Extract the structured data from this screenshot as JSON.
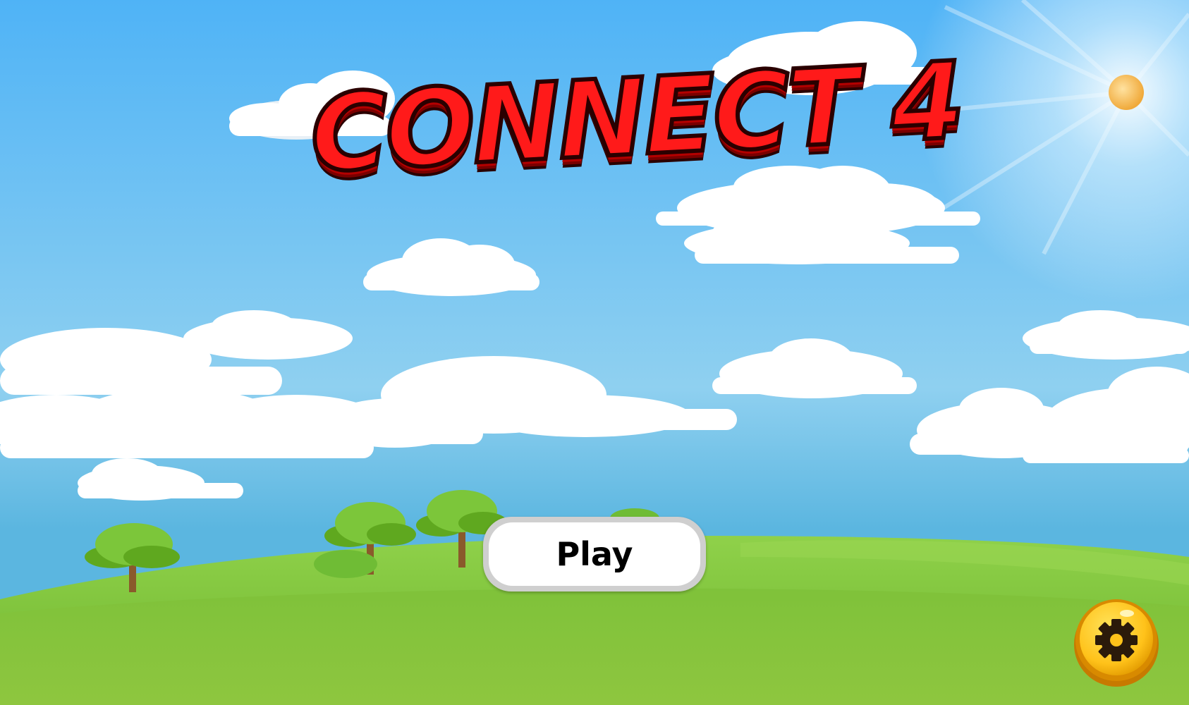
{
  "game": {
    "title": "CONNECT 4",
    "play_label": "Play",
    "settings_icon": "gear-icon"
  },
  "colors": {
    "sky_top": "#4fb3f6",
    "sky_bottom": "#bfe6f3",
    "grass": "#8cc63f",
    "title_red": "#ff1a1a",
    "settings_gold": "#ffc21a"
  }
}
